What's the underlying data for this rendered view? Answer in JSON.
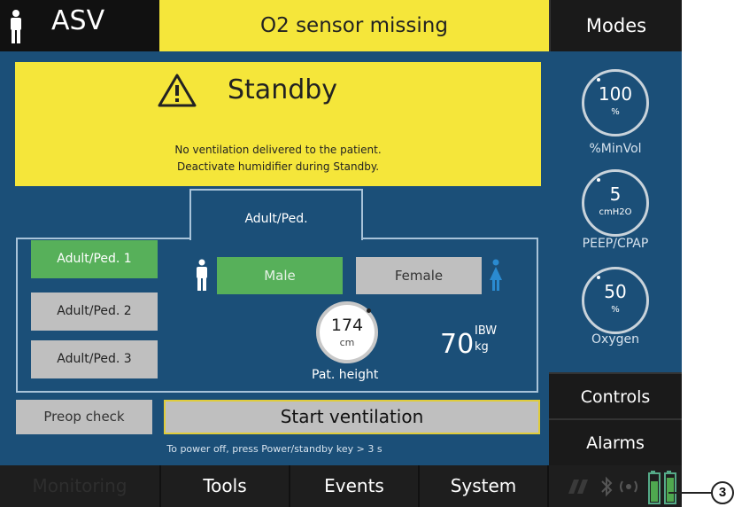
{
  "header": {
    "mode": "ASV",
    "alarm_message": "O2 sensor missing",
    "modes_label": "Modes"
  },
  "standby": {
    "title": "Standby",
    "line1": "No ventilation delivered to the patient.",
    "line2": "Deactivate humidifier during Standby."
  },
  "patient": {
    "tab_label": "Adult/Ped.",
    "groups": [
      "Adult/Ped. 1",
      "Adult/Ped. 2",
      "Adult/Ped. 3"
    ],
    "selected_group": "Adult/Ped. 1",
    "male_label": "Male",
    "female_label": "Female",
    "selected_gender": "Male",
    "height_value": "174",
    "height_unit": "cm",
    "height_label": "Pat. height",
    "ibw_value": "70",
    "ibw_label": "IBW",
    "ibw_unit": "kg"
  },
  "actions": {
    "preop_label": "Preop check",
    "start_label": "Start ventilation",
    "power_hint": "To power off,  press Power/standby key > 3 s"
  },
  "controls_panel": {
    "knobs": [
      {
        "value": "100",
        "unit": "%",
        "label": "%MinVol"
      },
      {
        "value": "5",
        "unit": "cmH2O",
        "label": "PEEP/CPAP"
      },
      {
        "value": "50",
        "unit": "%",
        "label": "Oxygen"
      }
    ],
    "controls_label": "Controls",
    "alarms_label": "Alarms"
  },
  "nav": {
    "tabs": [
      "Monitoring",
      "Tools",
      "Events",
      "System"
    ]
  },
  "status_icons": [
    "nebulizer-icon",
    "bluetooth-icon",
    "wireless-icon",
    "battery-icon",
    "battery-icon"
  ],
  "callout": "3",
  "colors": {
    "alarm_yellow": "#f5e63a",
    "screen_blue": "#1b4f78",
    "selected_green": "#57b05a",
    "button_gray": "#bfbfbf",
    "patient_female_blue": "#2a8ad0"
  }
}
